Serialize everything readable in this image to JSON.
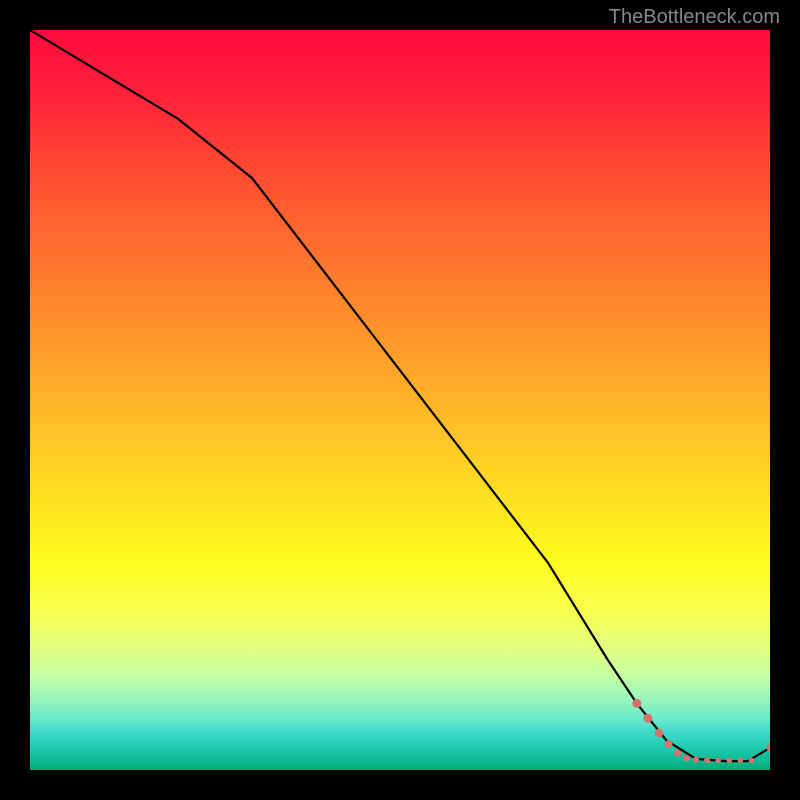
{
  "watermark": "TheBottleneck.com",
  "chart_data": {
    "type": "line",
    "title": "",
    "xlabel": "",
    "ylabel": "",
    "xlim": [
      0,
      100
    ],
    "ylim": [
      0,
      100
    ],
    "series": [
      {
        "name": "curve",
        "x": [
          0,
          10,
          20,
          30,
          40,
          50,
          60,
          70,
          78,
          82,
          86,
          90,
          94,
          97,
          100
        ],
        "y": [
          100,
          94,
          88,
          80,
          67,
          54,
          41,
          28,
          15,
          9,
          4,
          1.5,
          1.2,
          1.2,
          3
        ]
      }
    ],
    "markers": {
      "name": "dashed-markers",
      "color": "#d9716a",
      "points": [
        {
          "x": 82.0,
          "y": 9.0,
          "r": 3.2
        },
        {
          "x": 83.5,
          "y": 7.0,
          "r": 3.2
        },
        {
          "x": 85.0,
          "y": 5.0,
          "r": 3.0
        },
        {
          "x": 86.3,
          "y": 3.5,
          "r": 2.8
        },
        {
          "x": 87.5,
          "y": 2.3,
          "r": 2.6
        },
        {
          "x": 88.7,
          "y": 1.6,
          "r": 2.4
        },
        {
          "x": 90.0,
          "y": 1.4,
          "r": 2.2
        },
        {
          "x": 91.5,
          "y": 1.3,
          "r": 2.2
        },
        {
          "x": 93.0,
          "y": 1.3,
          "r": 2.0
        },
        {
          "x": 94.5,
          "y": 1.3,
          "r": 2.0
        },
        {
          "x": 96.0,
          "y": 1.3,
          "r": 2.0
        },
        {
          "x": 97.5,
          "y": 1.3,
          "r": 2.0
        },
        {
          "x": 100.0,
          "y": 3.0,
          "r": 2.5
        }
      ]
    },
    "background": {
      "type": "vertical-gradient",
      "stops": [
        {
          "pos": 0.0,
          "color": "#ff0a3c"
        },
        {
          "pos": 0.5,
          "color": "#ffd326"
        },
        {
          "pos": 0.75,
          "color": "#fdfd1e"
        },
        {
          "pos": 0.95,
          "color": "#3ed9c8"
        },
        {
          "pos": 1.0,
          "color": "#05aa73"
        }
      ]
    }
  }
}
